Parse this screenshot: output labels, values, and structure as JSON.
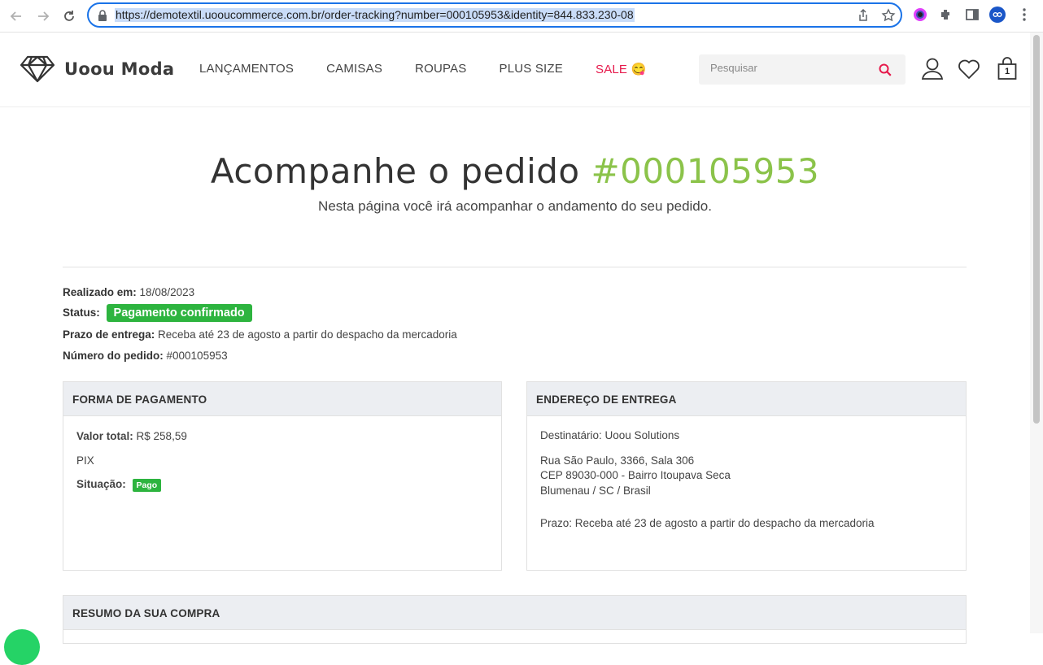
{
  "browser": {
    "url": "https://demotextil.uooucommerce.com.br/order-tracking?number=000105953&identity=844.833.230-08"
  },
  "site": {
    "brand": "Uoou Moda",
    "menu": [
      {
        "label": "LANÇAMENTOS"
      },
      {
        "label": "CAMISAS"
      },
      {
        "label": "ROUPAS"
      },
      {
        "label": "PLUS SIZE"
      },
      {
        "label": "SALE 😋"
      }
    ],
    "search_placeholder": "Pesquisar",
    "cart_count": "1",
    "colors": {
      "accent": "#8bc34a",
      "sale": "#e6194b",
      "badge": "#2db43f",
      "search_icon": "#e6194b"
    }
  },
  "order": {
    "title_prefix": "Acompanhe o pedido",
    "title_number": "#000105953",
    "subtitle": "Nesta página você irá acompanhar o andamento do seu pedido.",
    "placed_label": "Realizado em:",
    "placed_value": "18/08/2023",
    "status_label": "Status:",
    "status_value": "Pagamento confirmado",
    "deadline_label": "Prazo de entrega:",
    "deadline_value": "Receba até 23 de agosto a partir do despacho da mercadoria",
    "number_label": "Número do pedido:",
    "number_value": "#000105953"
  },
  "payment": {
    "heading": "FORMA DE PAGAMENTO",
    "total_label": "Valor total:",
    "total_value": "R$ 258,59",
    "method": "PIX",
    "situation_label": "Situação:",
    "situation_value": "Pago"
  },
  "shipping": {
    "heading": "ENDEREÇO DE ENTREGA",
    "recipient": "Destinatário: Uoou Solutions",
    "address_line1": "Rua São Paulo, 3366, Sala 306",
    "address_line2": "CEP 89030-000 - Bairro Itoupava Seca",
    "address_line3": "Blumenau / SC / Brasil",
    "deadline": "Prazo: Receba até 23 de agosto a partir do despacho da mercadoria"
  },
  "summary": {
    "heading": "RESUMO DA SUA COMPRA"
  }
}
